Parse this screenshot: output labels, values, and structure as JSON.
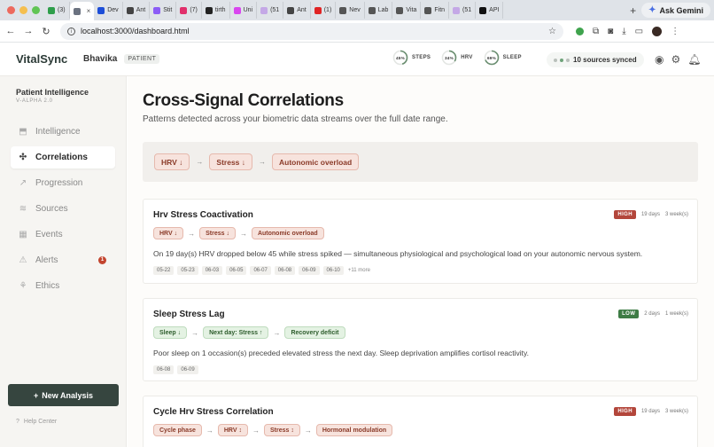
{
  "browser": {
    "tabs": [
      {
        "label": "(3)",
        "color": "#2e9e4b"
      },
      {
        "label": "",
        "color": "#6b7280",
        "active": true
      },
      {
        "label": "Dev",
        "color": "#1d4ed8"
      },
      {
        "label": "Ant",
        "color": "#444444"
      },
      {
        "label": "Stit",
        "color": "#8b5cf6"
      },
      {
        "label": "(7)",
        "color": "#e1306c"
      },
      {
        "label": "tirth",
        "color": "#222222"
      },
      {
        "label": "Uni",
        "color": "#d946ef"
      },
      {
        "label": "(51",
        "color": "#c4a8e6"
      },
      {
        "label": "Ant",
        "color": "#444444"
      },
      {
        "label": "(1)",
        "color": "#e02424"
      },
      {
        "label": "Nev",
        "color": "#555555"
      },
      {
        "label": "Lab",
        "color": "#555555"
      },
      {
        "label": "Vita",
        "color": "#555555"
      },
      {
        "label": "Fitn",
        "color": "#555555"
      },
      {
        "label": "(51",
        "color": "#c4a8e6"
      },
      {
        "label": "API",
        "color": "#111111"
      }
    ],
    "gemini_label": "Ask Gemini",
    "url": "localhost:3000/dashboard.html"
  },
  "header": {
    "brand": "VitalSync",
    "user": "Bhavika",
    "role": "PATIENT",
    "rings": [
      {
        "value": "45%",
        "label": "STEPS",
        "fraction": 0.45,
        "color": "#6b8f71"
      },
      {
        "value": "34%",
        "label": "HRV",
        "fraction": 0.34,
        "color": "#6b8f71"
      },
      {
        "value": "69%",
        "label": "SLEEP",
        "fraction": 0.69,
        "color": "#6b8f71"
      }
    ],
    "sync_text": "10 sources synced",
    "sync_dots": [
      "#b9c0bb",
      "#6ea37a",
      "#b9c0bb"
    ]
  },
  "sidebar": {
    "title": "Patient Intelligence",
    "version": "V-ALPHA 2.0",
    "items": [
      {
        "label": "Intelligence",
        "icon": "⬒",
        "active": false
      },
      {
        "label": "Correlations",
        "icon": "✣",
        "active": true
      },
      {
        "label": "Progression",
        "icon": "↗",
        "active": false
      },
      {
        "label": "Sources",
        "icon": "≋",
        "active": false
      },
      {
        "label": "Events",
        "icon": "▦",
        "active": false
      },
      {
        "label": "Alerts",
        "icon": "⚠",
        "active": false,
        "badge": "1"
      },
      {
        "label": "Ethics",
        "icon": "⚘",
        "active": false
      }
    ],
    "new_analysis": "New Analysis",
    "help": "Help Center"
  },
  "main": {
    "title": "Cross-Signal Correlations",
    "subtitle": "Patterns detected across your biometric data streams over the full date range.",
    "flow": [
      {
        "label": "HRV ↓",
        "tone": "red"
      },
      {
        "label": "Stress ↓",
        "tone": "red"
      },
      {
        "label": "Autonomic overload",
        "tone": "red"
      }
    ],
    "cards": [
      {
        "title": "Hrv Stress Coactivation",
        "severity": "HIGH",
        "sev_class": "high",
        "days": "19 days",
        "weeks": "3 week(s)",
        "chain": [
          {
            "label": "HRV ↓",
            "tone": "red"
          },
          {
            "label": "Stress ↓",
            "tone": "red"
          },
          {
            "label": "Autonomic overload",
            "tone": "red"
          }
        ],
        "description": "On 19 day(s) HRV dropped below 45 while stress spiked — simultaneous physiological and psychological load on your autonomic nervous system.",
        "dates": [
          "05-22",
          "05-23",
          "06-03",
          "06-05",
          "06-07",
          "06-08",
          "06-09",
          "06-10"
        ],
        "more": "+11 more"
      },
      {
        "title": "Sleep Stress Lag",
        "severity": "LOW",
        "sev_class": "low",
        "days": "2 days",
        "weeks": "1 week(s)",
        "chain": [
          {
            "label": "Sleep ↓",
            "tone": "green"
          },
          {
            "label": "Next day: Stress ↑",
            "tone": "green"
          },
          {
            "label": "Recovery deficit",
            "tone": "green"
          }
        ],
        "description": "Poor sleep on 1 occasion(s) preceded elevated stress the next day. Sleep deprivation amplifies cortisol reactivity.",
        "dates": [
          "06-08",
          "06-09"
        ],
        "more": ""
      },
      {
        "title": "Cycle Hrv Stress Correlation",
        "severity": "HIGH",
        "sev_class": "high",
        "days": "19 days",
        "weeks": "3 week(s)",
        "chain": [
          {
            "label": "Cycle phase",
            "tone": "red"
          },
          {
            "label": "HRV ↕",
            "tone": "red"
          },
          {
            "label": "Stress ↕",
            "tone": "red"
          },
          {
            "label": "Hormonal modulation",
            "tone": "red"
          }
        ],
        "description": "",
        "dates": [],
        "more": ""
      }
    ]
  }
}
